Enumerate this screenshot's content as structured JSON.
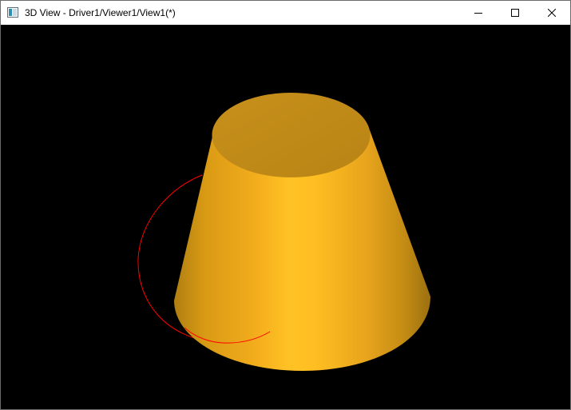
{
  "window": {
    "title": "3D View - Driver1/Viewer1/View1(*)",
    "controls": {
      "minimize_icon": "minimize-icon",
      "maximize_icon": "maximize-icon",
      "close_icon": "close-icon"
    }
  },
  "viewport": {
    "background": "#000000",
    "objects": {
      "cone": {
        "color": "#ffb21a"
      },
      "circle_edge": {
        "color": "#ff0000"
      }
    }
  }
}
